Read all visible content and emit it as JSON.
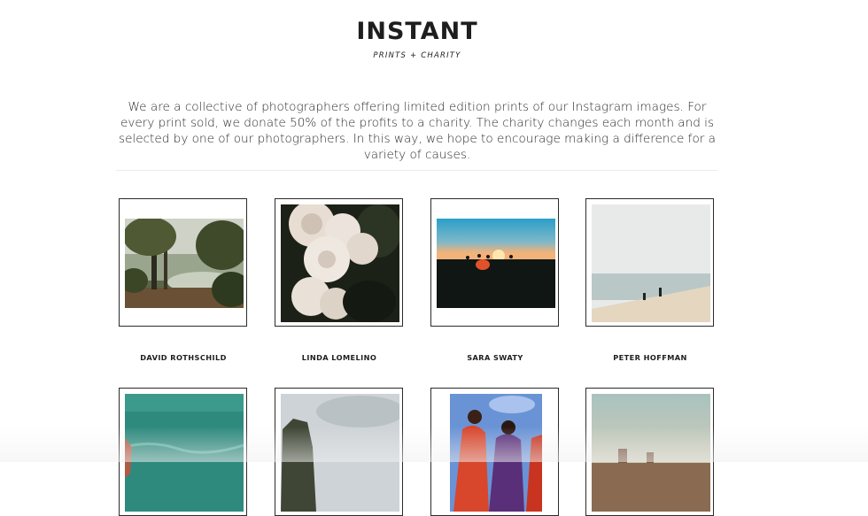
{
  "site": {
    "brand": "INSTANT",
    "tagline": "PRINTS + CHARITY",
    "intro": "We are a collective of photographers offering limited edition prints of our Instagram images. For every print sold, we donate 50% of the profits to a charity. The charity changes each month and is selected by one of our photographers.  In this way, we hope to encourage making a difference for a variety of causes."
  },
  "photographers": [
    {
      "name": "DAVID ROTHSCHILD"
    },
    {
      "name": "LINDA LOMELINO"
    },
    {
      "name": "SARA SWATY"
    },
    {
      "name": "PETER HOFFMAN"
    }
  ]
}
